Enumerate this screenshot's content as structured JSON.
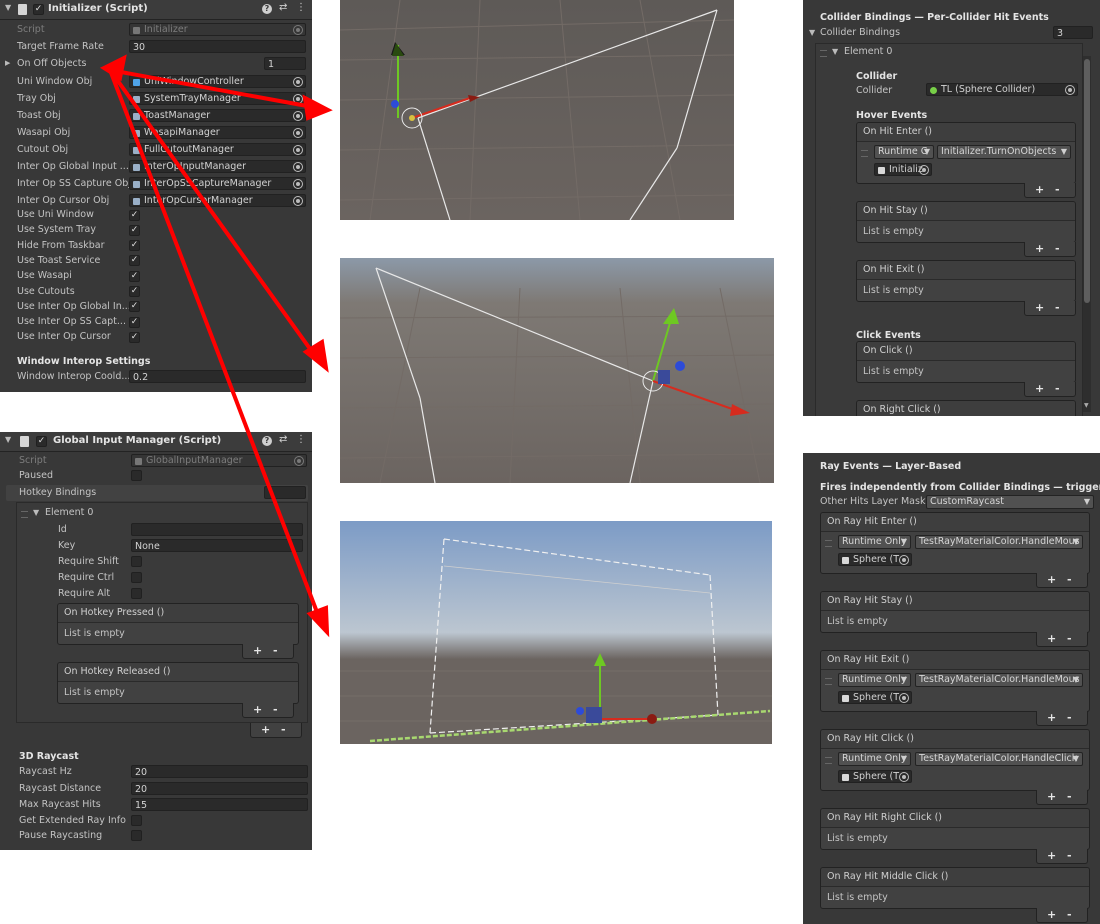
{
  "initializer": {
    "title": "Initializer (Script)",
    "script_label": "Script",
    "script_value": "Initializer",
    "target_frame_rate_label": "Target Frame Rate",
    "target_frame_rate_value": "30",
    "on_off_objects_label": "On Off Objects",
    "on_off_objects_count": "1",
    "object_fields": [
      {
        "label": "Uni Window Obj",
        "value": "UniWindowController"
      },
      {
        "label": "Tray Obj",
        "value": "SystemTrayManager"
      },
      {
        "label": "Toast Obj",
        "value": "ToastManager"
      },
      {
        "label": "Wasapi Obj",
        "value": "WasapiManager"
      },
      {
        "label": "Cutout Obj",
        "value": "FullCutoutManager"
      },
      {
        "label": "Inter Op Global Input ...",
        "value": "InterOpInputManager"
      },
      {
        "label": "Inter Op SS Capture Obj",
        "value": "InterOpSSCaptureManager"
      },
      {
        "label": "Inter Op Cursor Obj",
        "value": "InterOpCursorManager"
      }
    ],
    "toggles": [
      {
        "label": "Use Uni Window",
        "checked": true
      },
      {
        "label": "Use System Tray",
        "checked": true
      },
      {
        "label": "Hide From Taskbar",
        "checked": true
      },
      {
        "label": "Use Toast Service",
        "checked": true
      },
      {
        "label": "Use Wasapi",
        "checked": true
      },
      {
        "label": "Use Cutouts",
        "checked": true
      },
      {
        "label": "Use Inter Op Global In...",
        "checked": true
      },
      {
        "label": "Use Inter Op SS Capt...",
        "checked": true
      },
      {
        "label": "Use Inter Op Cursor",
        "checked": true
      }
    ],
    "window_interop_header": "Window Interop Settings",
    "window_interop_cooldown_label": "Window Interop Coold...",
    "window_interop_cooldown_value": "0.2"
  },
  "global_input": {
    "title": "Global Input Manager (Script)",
    "script_label": "Script",
    "script_value": "GlobalInputManager",
    "paused_label": "Paused",
    "hotkey_bindings_label": "Hotkey Bindings",
    "element_label": "Element 0",
    "id_label": "Id",
    "id_value": "",
    "key_label": "Key",
    "key_value": "None",
    "require_shift_label": "Require Shift",
    "require_ctrl_label": "Require Ctrl",
    "require_alt_label": "Require Alt",
    "on_hotkey_pressed": "On Hotkey Pressed ()",
    "on_hotkey_released": "On Hotkey Released ()",
    "list_empty": "List is empty",
    "raycast_header": "3D Raycast",
    "raycast_hz_label": "Raycast Hz",
    "raycast_hz_value": "20",
    "raycast_distance_label": "Raycast Distance",
    "raycast_distance_value": "20",
    "max_raycast_hits_label": "Max Raycast Hits",
    "max_raycast_hits_value": "15",
    "get_extended_label": "Get Extended Ray Info",
    "pause_raycasting_label": "Pause Raycasting"
  },
  "collider_bindings": {
    "title": "Collider Bindings — Per-Collider Hit Events",
    "label": "Collider Bindings",
    "count": "3",
    "element_label": "Element 0",
    "collider_header": "Collider",
    "collider_label": "Collider",
    "collider_value": "TL (Sphere Collider)",
    "hover_events_header": "Hover Events",
    "on_hit_enter": "On Hit Enter ()",
    "runtime_value": "Runtime C",
    "function_value": "Initializer.TurnOnObjects",
    "object_value": "Initializ",
    "on_hit_stay": "On Hit Stay ()",
    "on_hit_exit": "On Hit Exit ()",
    "list_empty": "List is empty",
    "click_events_header": "Click Events",
    "on_click": "On Click ()",
    "on_right_click": "On Right Click ()"
  },
  "ray_events": {
    "title": "Ray Events — Layer-Based",
    "description": "Fires independently from Collider Bindings — triggers for any",
    "layer_mask_label": "Other Hits Layer Mask",
    "layer_mask_value": "CustomRaycast",
    "runtime_only": "Runtime Only",
    "sphere_value": "Sphere (T",
    "list_empty": "List is empty",
    "events": [
      {
        "title": "On Ray Hit Enter ()",
        "function": "TestRayMaterialColor.HandleMous"
      },
      {
        "title": "On Ray Hit Stay ()",
        "function": ""
      },
      {
        "title": "On Ray Hit Exit ()",
        "function": "TestRayMaterialColor.HandleMous"
      },
      {
        "title": "On Ray Hit Click ()",
        "function": "TestRayMaterialColor.HandleClick"
      },
      {
        "title": "On Ray Hit Right Click ()",
        "function": ""
      },
      {
        "title": "On Ray Hit Middle Click ()",
        "function": ""
      }
    ]
  },
  "colors": {
    "panel_bg": "#383838",
    "field_bg": "#2a2a2a",
    "arrow_red": "#ff0000",
    "gizmo_green": "#6ec823",
    "gizmo_blue": "#2d4bd8",
    "gizmo_red": "#d62b1e"
  }
}
